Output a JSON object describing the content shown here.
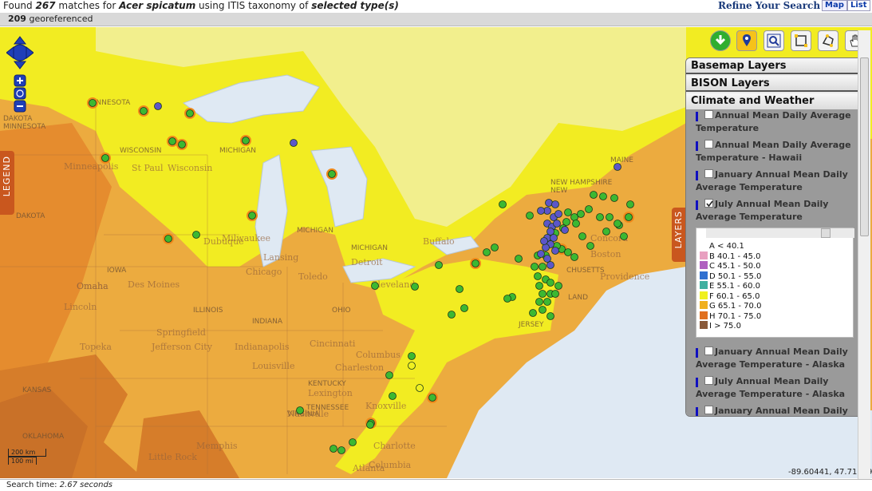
{
  "header": {
    "found_prefix": "Found",
    "match_count": "267",
    "matches_for": "matches for",
    "species": "Acer spicatum",
    "using": "using ITIS taxonomy of",
    "type": "selected type(s)",
    "refine_label": "Refine Your Search",
    "map_tab": "Map",
    "list_tab": "List"
  },
  "subheader": {
    "georef_count": "209",
    "georef_label": "georeferenced"
  },
  "map": {
    "labels": [
      {
        "text": "MINNESOTA",
        "kind": "small"
      },
      {
        "text": "MINNESOTA",
        "kind": "small"
      },
      {
        "text": "WISCONSIN",
        "kind": "small"
      },
      {
        "text": "Wisconsin",
        "kind": "city"
      },
      {
        "text": "Minneapolis",
        "kind": "city"
      },
      {
        "text": "St Paul",
        "kind": "city"
      },
      {
        "text": "MICHIGAN",
        "kind": "small"
      },
      {
        "text": "MICHIGAN",
        "kind": "small"
      },
      {
        "text": "Milwaukee",
        "kind": "city"
      },
      {
        "text": "Lansing",
        "kind": "city"
      },
      {
        "text": "Detroit",
        "kind": "city"
      },
      {
        "text": "Chicago",
        "kind": "city"
      },
      {
        "text": "Toledo",
        "kind": "city"
      },
      {
        "text": "Cleveland",
        "kind": "city"
      },
      {
        "text": "Buffalo",
        "kind": "city"
      },
      {
        "text": "NEW HAMPSHIRE",
        "kind": "small"
      },
      {
        "text": "MAINE",
        "kind": "small"
      },
      {
        "text": "Concord",
        "kind": "city"
      },
      {
        "text": "Boston",
        "kind": "city"
      },
      {
        "text": "Providence",
        "kind": "city"
      },
      {
        "text": "IOWA",
        "kind": "small"
      },
      {
        "text": "Omaha",
        "kind": "city"
      },
      {
        "text": "Des Moines",
        "kind": "city"
      },
      {
        "text": "Lincoln",
        "kind": "city"
      },
      {
        "text": "ILLINOIS",
        "kind": "small"
      },
      {
        "text": "INDIANA",
        "kind": "small"
      },
      {
        "text": "OHIO",
        "kind": "small"
      },
      {
        "text": "Springfield",
        "kind": "city"
      },
      {
        "text": "Indianapolis",
        "kind": "city"
      },
      {
        "text": "Columbus",
        "kind": "city"
      },
      {
        "text": "Cincinnati",
        "kind": "city"
      },
      {
        "text": "Topeka",
        "kind": "city"
      },
      {
        "text": "Jefferson City",
        "kind": "city"
      },
      {
        "text": "Louisville",
        "kind": "city"
      },
      {
        "text": "Lexington",
        "kind": "city"
      },
      {
        "text": "KENTUCKY",
        "kind": "small"
      },
      {
        "text": "Charleston",
        "kind": "city"
      },
      {
        "text": "VIRGINIA",
        "kind": "small"
      },
      {
        "text": "Nashville",
        "kind": "city"
      },
      {
        "text": "Knoxville",
        "kind": "city"
      },
      {
        "text": "TENNESSEE",
        "kind": "small"
      },
      {
        "text": "Memphis",
        "kind": "city"
      },
      {
        "text": "Little Rock",
        "kind": "city"
      },
      {
        "text": "OKLAHOMA",
        "kind": "small"
      },
      {
        "text": "KANSAS",
        "kind": "small"
      },
      {
        "text": "Charlotte",
        "kind": "city"
      },
      {
        "text": "Columbia",
        "kind": "city"
      },
      {
        "text": "Atlanta",
        "kind": "city"
      },
      {
        "text": "Omaha",
        "kind": "city"
      },
      {
        "text": "DAKOTA",
        "kind": "small"
      },
      {
        "text": "DAKOTA",
        "kind": "small"
      },
      {
        "text": "MICHIGAN",
        "kind": "small"
      },
      {
        "text": "JERSEY",
        "kind": "small"
      },
      {
        "text": "NEW",
        "kind": "small"
      },
      {
        "text": "LAND",
        "kind": "small"
      },
      {
        "text": "CHUSETTS",
        "kind": "small"
      },
      {
        "text": "Dubuque",
        "kind": "city"
      }
    ],
    "scale_km": "200 km",
    "scale_mi": "100 mi",
    "coordinates": "-89.60441, 47.71309"
  },
  "tools": [
    {
      "name": "download-icon",
      "title": "Download"
    },
    {
      "name": "identify-pin-icon",
      "title": "Identify"
    },
    {
      "name": "zoom-box-icon",
      "title": "Zoom"
    },
    {
      "name": "select-box-icon",
      "title": "Select rectangle"
    },
    {
      "name": "select-polygon-icon",
      "title": "Select polygon"
    },
    {
      "name": "pan-hand-icon",
      "title": "Pan"
    }
  ],
  "legend_tab": "LEGEND",
  "layers_tab": "LAYERS",
  "panel": {
    "basemap_layers": "Basemap Layers",
    "bison_layers": "BISON Layers",
    "climate_weather": "Climate and Weather",
    "layers": [
      {
        "label": "Annual Mean Daily Average Temperature",
        "checked": false
      },
      {
        "label": "Annual Mean Daily Average Temperature - Hawaii",
        "checked": false
      },
      {
        "label": "January Annual Mean Daily Average Temperature",
        "checked": false
      },
      {
        "label": "July Annual Mean Daily Average Temperature",
        "checked": true
      },
      {
        "label": "January Annual Mean Daily Average Temperature - Alaska",
        "checked": false
      },
      {
        "label": "July Annual Mean Daily Average Temperature - Alaska",
        "checked": false
      },
      {
        "label": "January Annual Mean Daily Average Temperature - Hawaii",
        "checked": false
      }
    ],
    "legend_classes": [
      {
        "label": "A < 40.1",
        "color": "#ffffff"
      },
      {
        "label": "B 40.1 - 45.0",
        "color": "#e8a0c0"
      },
      {
        "label": "C 45.1 - 50.0",
        "color": "#b060c0"
      },
      {
        "label": "D 50.1 - 55.0",
        "color": "#3070d0"
      },
      {
        "label": "E 55.1 - 60.0",
        "color": "#40b0a0"
      },
      {
        "label": "F 60.1 - 65.0",
        "color": "#f0f020"
      },
      {
        "label": "G 65.1 - 70.0",
        "color": "#f0b020"
      },
      {
        "label": "H 70.1 - 75.0",
        "color": "#e07020"
      },
      {
        "label": "I > 75.0",
        "color": "#8a5a3a"
      }
    ]
  },
  "footer": {
    "search_time_label": "Search time:",
    "search_time_value": "2.67 seconds"
  },
  "colors": {
    "zone_yellow": "#f2f01e",
    "zone_lightorange": "#efb533",
    "zone_orange": "#e88a2e",
    "water": "#d8e6f2",
    "occurrence_green": "#3cb832",
    "occurrence_purple": "#5c56c8",
    "occurrence_yellow": "#f0f020"
  }
}
